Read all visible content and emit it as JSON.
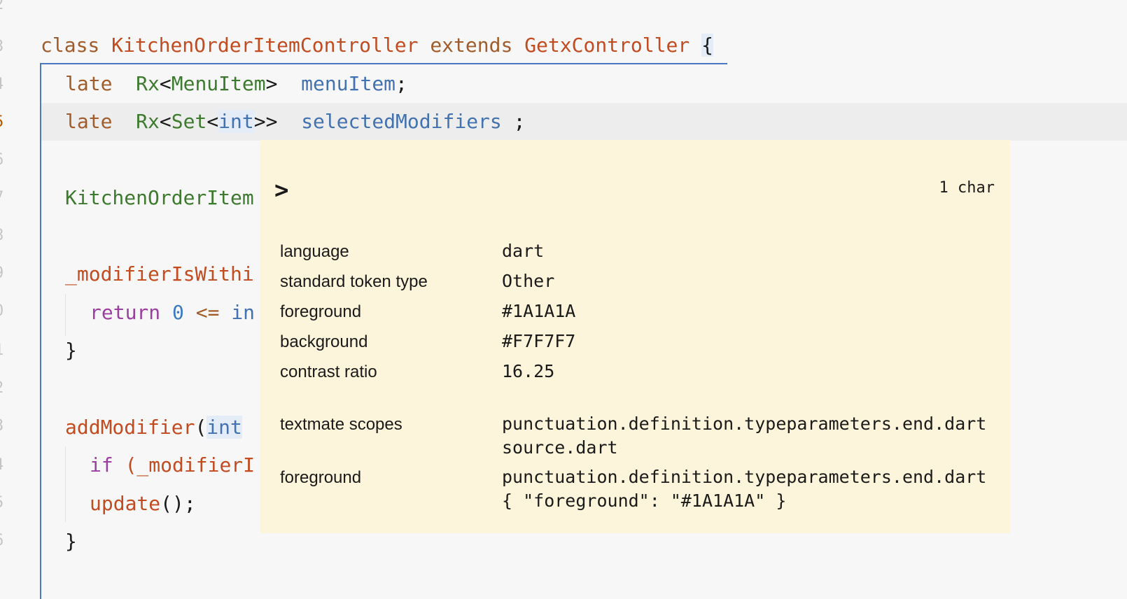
{
  "gutter": {
    "line_numbers": [
      "2",
      "3",
      "4",
      "5",
      "6",
      "7",
      "8",
      "9",
      "0",
      "1",
      "2",
      "3",
      "4",
      "5",
      "6"
    ]
  },
  "code": {
    "line3": {
      "kw1": "class",
      "name": "KitchenOrderItemController",
      "kw2": "extends",
      "base": "GetxController",
      "brace": "{"
    },
    "line4": {
      "kw": "late",
      "type1": "Rx",
      "lt": "<",
      "type2": "MenuItem",
      "gt": ">",
      "var": "menuItem",
      "semi": ";"
    },
    "line5": {
      "kw": "late",
      "type1": "Rx",
      "lt1": "<",
      "type2": "Set",
      "lt2": "<",
      "type3": "int",
      "gt": ">>",
      "var": "selectedModifiers",
      "semi": " ;"
    },
    "line7": {
      "text": "KitchenOrderItem"
    },
    "line9": {
      "text": "_modifierIsWithi"
    },
    "line10": {
      "ctl": "return",
      "num": "0",
      "op": "<=",
      "rest": "in"
    },
    "line11": {
      "text": "}"
    },
    "line13": {
      "fn": "addModifier",
      "paren": "(",
      "type": "int"
    },
    "line14": {
      "ctl": "if",
      "rest": "(_modifierI"
    },
    "line15": {
      "fn": "update",
      "rest": "();"
    },
    "line16": {
      "text": "}"
    }
  },
  "popup": {
    "char": ">",
    "count": "1 char",
    "properties": [
      {
        "label": "language",
        "value": "dart"
      },
      {
        "label": "standard token type",
        "value": "Other"
      },
      {
        "label": "foreground",
        "value": "#1A1A1A"
      },
      {
        "label": "background",
        "value": "#F7F7F7"
      },
      {
        "label": "contrast ratio",
        "value": "16.25"
      }
    ],
    "scopes_label": "textmate scopes",
    "scopes_line1": "punctuation.definition.typeparameters.end.dart",
    "scopes_line2": "source.dart",
    "fg_label": "foreground",
    "fg_line1": "punctuation.definition.typeparameters.end.dart",
    "fg_line2": "{ \"foreground\": \"#1A1A1A\" }"
  },
  "colors": {
    "editor_bg": "#F7F7F7",
    "popup_bg": "#FDF5DB",
    "scope_border": "#4A78C2"
  }
}
